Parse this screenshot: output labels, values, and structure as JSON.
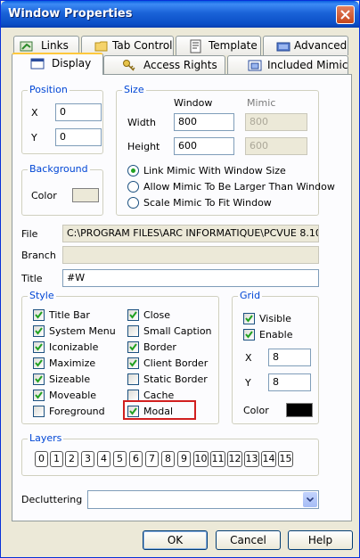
{
  "window": {
    "title": "Window Properties"
  },
  "tabs_back": [
    {
      "label": "Links",
      "icon": "links-icon"
    },
    {
      "label": "Tab Control",
      "icon": "folder-icon"
    },
    {
      "label": "Template",
      "icon": "template-icon"
    },
    {
      "label": "Advanced",
      "icon": "advanced-icon"
    }
  ],
  "tabs_front": [
    {
      "label": "Display",
      "icon": "display-icon",
      "active": true
    },
    {
      "label": "Access Rights",
      "icon": "keys-icon"
    },
    {
      "label": "Included Mimic",
      "icon": "mimic-icon"
    }
  ],
  "position": {
    "title": "Position",
    "x_label": "X",
    "x_value": "0",
    "y_label": "Y",
    "y_value": "0"
  },
  "background": {
    "title": "Background",
    "color_label": "Color",
    "color": "#ece9d8"
  },
  "size": {
    "title": "Size",
    "col_window": "Window",
    "col_mimic": "Mimic",
    "width_label": "Width",
    "width_window": "800",
    "width_mimic": "800",
    "height_label": "Height",
    "height_window": "600",
    "height_mimic": "600",
    "options": [
      {
        "label": "Link Mimic With Window Size",
        "selected": true
      },
      {
        "label": "Allow Mimic To Be Larger Than Window",
        "selected": false
      },
      {
        "label": "Scale Mimic To Fit Window",
        "selected": false
      }
    ]
  },
  "fields": {
    "file_label": "File",
    "file_value": "C:\\PROGRAM FILES\\ARC INFORMATIQUE\\PCVUE 8.10",
    "branch_label": "Branch",
    "branch_value": "",
    "title_label": "Title",
    "title_value": "#W"
  },
  "style": {
    "title": "Style",
    "left": [
      {
        "label": "Title Bar",
        "checked": true
      },
      {
        "label": "System Menu",
        "checked": true
      },
      {
        "label": "Iconizable",
        "checked": true
      },
      {
        "label": "Maximize",
        "checked": true
      },
      {
        "label": "Sizeable",
        "checked": true
      },
      {
        "label": "Moveable",
        "checked": true
      },
      {
        "label": "Foreground",
        "checked": false
      }
    ],
    "right": [
      {
        "label": "Close",
        "checked": true
      },
      {
        "label": "Small Caption",
        "checked": false
      },
      {
        "label": "Border",
        "checked": true
      },
      {
        "label": "Client Border",
        "checked": true
      },
      {
        "label": "Static Border",
        "checked": false
      },
      {
        "label": "Cache",
        "checked": false
      },
      {
        "label": "Modal",
        "checked": true
      }
    ]
  },
  "grid": {
    "title": "Grid",
    "visible_label": "Visible",
    "visible": true,
    "enable_label": "Enable",
    "enable": true,
    "x_label": "X",
    "x_value": "8",
    "y_label": "Y",
    "y_value": "8",
    "color_label": "Color",
    "color": "#000000"
  },
  "layers": {
    "title": "Layers",
    "items": [
      "0",
      "1",
      "2",
      "3",
      "4",
      "5",
      "6",
      "7",
      "8",
      "9",
      "10",
      "11",
      "12",
      "13",
      "14",
      "15"
    ]
  },
  "decluttering": {
    "label": "Decluttering",
    "value": ""
  },
  "buttons": {
    "ok": "OK",
    "cancel": "Cancel",
    "help": "Help"
  },
  "colors": {
    "group_label": "#0046d5",
    "highlight": "#d11f1f",
    "title_bar": "#0a5fe0"
  }
}
